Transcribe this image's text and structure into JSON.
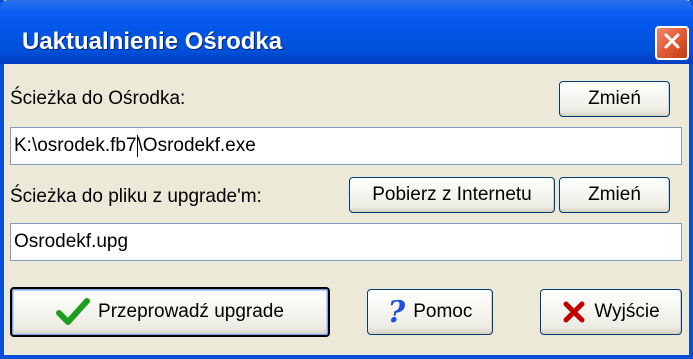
{
  "window": {
    "title": "Uaktualnienie Ośrodka"
  },
  "center_path": {
    "label": "Ścieżka do Ośrodka:",
    "change_button": "Zmień",
    "value_before_cursor": "K:\\osrodek.fb7",
    "value_after_cursor": "\\Osrodekf.exe"
  },
  "upgrade_path": {
    "label": "Ścieżka do pliku z upgrade'm:",
    "download_button": "Pobierz z Internetu",
    "change_button": "Zmień",
    "value": "Osrodekf.upg"
  },
  "actions": {
    "upgrade_button": "Przeprowadź upgrade",
    "help_button": "Pomoc",
    "exit_button": "Wyjście"
  },
  "icons": {
    "close": "close-icon",
    "upgrade": "checkmark-icon",
    "help": "question-mark-icon",
    "exit": "cross-icon"
  },
  "colors": {
    "titlebar": "#0054E3",
    "close_button": "#E25A36",
    "dialog_background": "#ECE9D8",
    "checkmark": "#1E9E1E",
    "help_icon": "#1F4FD8",
    "exit_icon": "#C00000"
  }
}
